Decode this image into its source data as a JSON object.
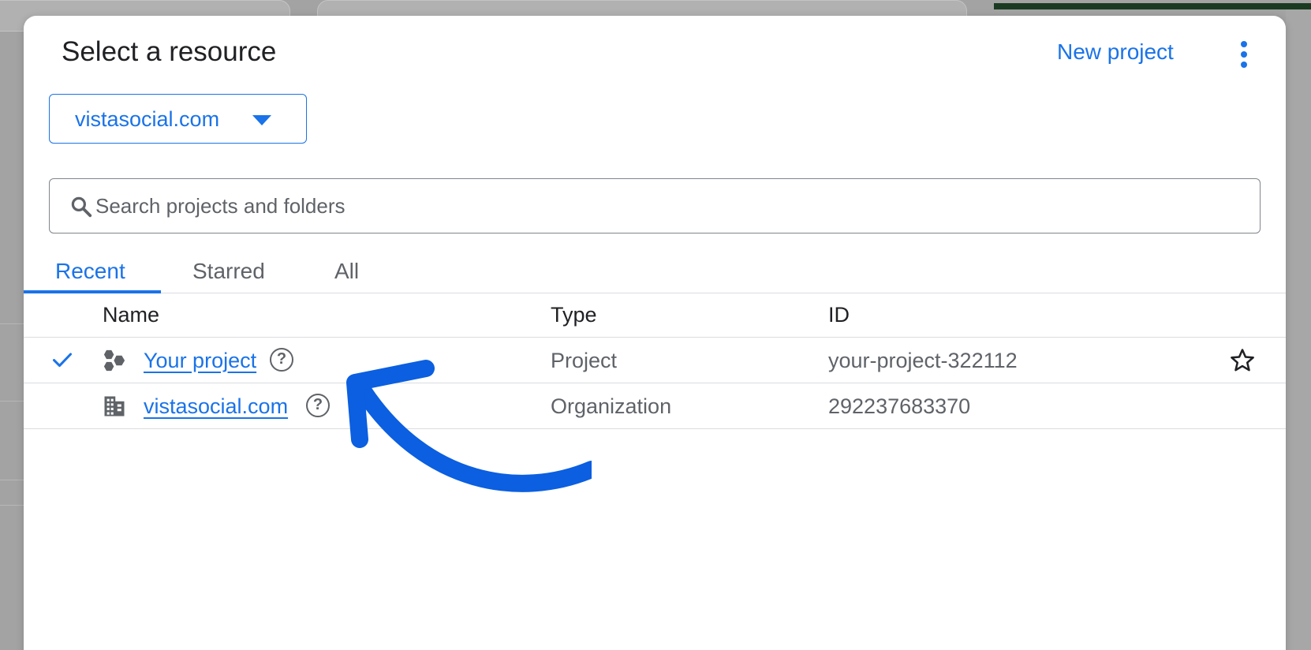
{
  "dialog": {
    "title": "Select a resource",
    "new_project_label": "New project",
    "more_icon": "more-vert-icon"
  },
  "org_select": {
    "value": "vistasocial.com"
  },
  "search": {
    "placeholder": "Search projects and folders",
    "value": ""
  },
  "tabs": [
    {
      "label": "Recent",
      "active": true
    },
    {
      "label": "Starred",
      "active": false
    },
    {
      "label": "All",
      "active": false
    }
  ],
  "table": {
    "columns": [
      "Name",
      "Type",
      "ID"
    ],
    "rows": [
      {
        "name": "Your project",
        "type": "Project",
        "id": "your-project-322112",
        "selected": true,
        "icon": "project-icon"
      },
      {
        "name": "vistasocial.com",
        "type": "Organization",
        "id": "292237683370",
        "selected": false,
        "icon": "organization-icon"
      }
    ]
  },
  "colors": {
    "accent": "#1a73e8",
    "text": "#202124",
    "muted": "#5f6368",
    "arrow": "#0b5fe0"
  }
}
